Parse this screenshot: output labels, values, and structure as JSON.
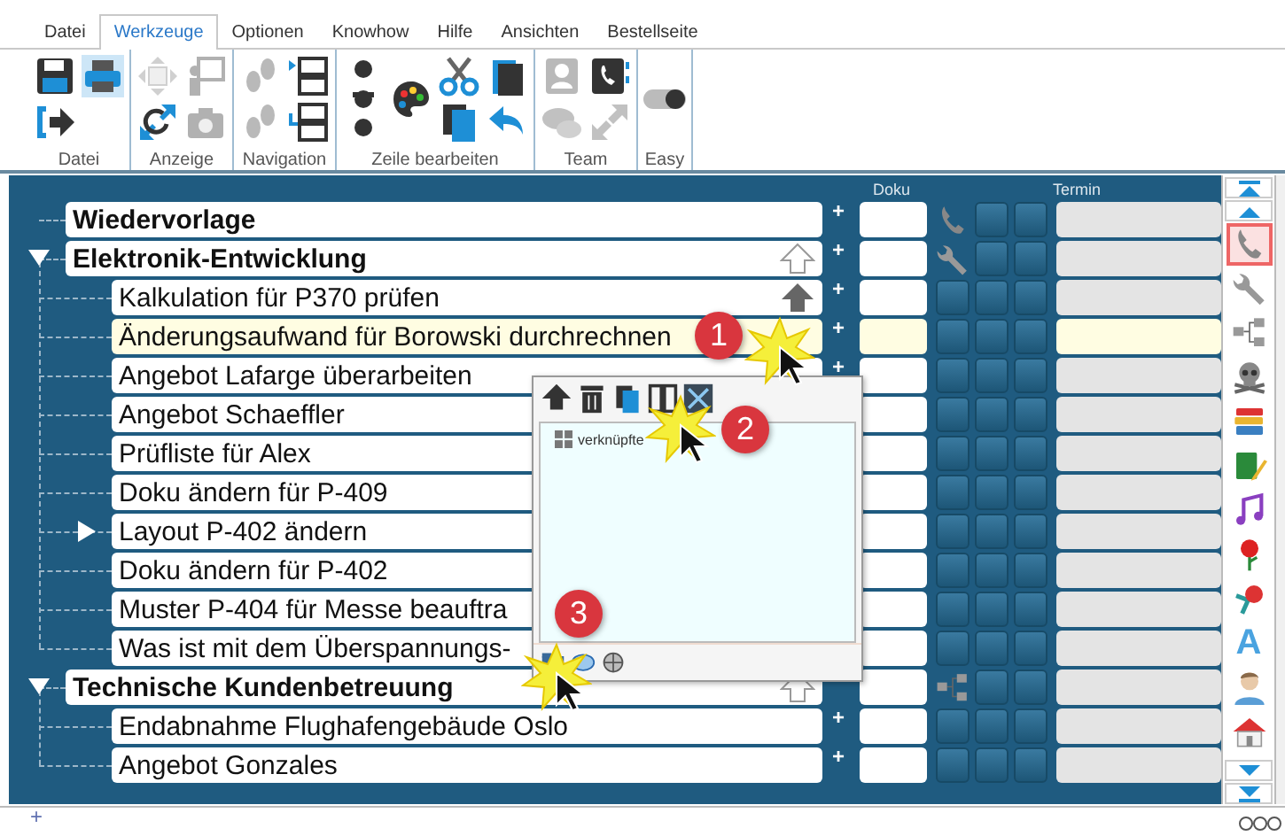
{
  "tabs": [
    {
      "label": "Datei",
      "selected": false
    },
    {
      "label": "Werkzeuge",
      "selected": true
    },
    {
      "label": "Optionen",
      "selected": false
    },
    {
      "label": "Knowhow",
      "selected": false
    },
    {
      "label": "Hilfe",
      "selected": false
    },
    {
      "label": "Ansichten",
      "selected": false
    },
    {
      "label": "Bestellseite",
      "selected": false
    }
  ],
  "ribbon": {
    "groups": [
      {
        "label": "Datei",
        "tools": [
          {
            "kind": "save",
            "disabled": false,
            "selected": false
          },
          {
            "kind": "exit",
            "disabled": false,
            "selected": false
          },
          {
            "kind": "print",
            "disabled": false,
            "selected": true
          }
        ]
      },
      {
        "label": "Anzeige",
        "tools": [
          {
            "kind": "move",
            "disabled": true,
            "selected": false
          },
          {
            "kind": "zoom",
            "disabled": false,
            "selected": false
          },
          {
            "kind": "presenter",
            "disabled": true,
            "selected": false
          },
          {
            "kind": "camera",
            "disabled": true,
            "selected": false
          }
        ]
      },
      {
        "label": "Navigation",
        "tools": [
          {
            "kind": "steps",
            "disabled": true,
            "selected": false
          },
          {
            "kind": "steps",
            "disabled": true,
            "selected": false
          },
          {
            "kind": "boxes_top",
            "disabled": false,
            "selected": false
          },
          {
            "kind": "boxes_bottom",
            "disabled": false,
            "selected": false
          }
        ]
      },
      {
        "label": "Zeile bearbeiten",
        "tools": [
          {
            "kind": "textstyle",
            "disabled": false,
            "selected": false
          },
          {
            "kind": "palette",
            "disabled": false,
            "selected": false
          },
          {
            "kind": "scissors",
            "disabled": false,
            "selected": false
          },
          {
            "kind": "copy",
            "disabled": false,
            "selected": false
          },
          {
            "kind": "paste",
            "disabled": false,
            "selected": false
          },
          {
            "kind": "undo",
            "disabled": false,
            "selected": false
          }
        ]
      },
      {
        "label": "Team",
        "tools": [
          {
            "kind": "contacts",
            "disabled": true,
            "selected": false
          },
          {
            "kind": "chat",
            "disabled": true,
            "selected": false
          },
          {
            "kind": "phonebook",
            "disabled": false,
            "selected": false
          },
          {
            "kind": "share",
            "disabled": true,
            "selected": false
          }
        ]
      },
      {
        "label": "Easy",
        "tools": [
          {
            "kind": "toggle",
            "disabled": false,
            "selected": false
          }
        ]
      }
    ]
  },
  "grid": {
    "columns": [
      {
        "label": "Doku"
      },
      {
        "label": "Termin"
      }
    ],
    "rows": [
      {
        "label": "Wiedervorlage",
        "selected": false,
        "plus": "+",
        "slot": {
          "kind": "phone"
        }
      },
      {
        "label": "Elektronik-Entwicklung",
        "selected": false,
        "expanded": true,
        "marker": {
          "kind": "outline"
        },
        "plus": "+",
        "slot": {
          "kind": "wrench"
        },
        "children": [
          {
            "label": "Kalkulation für P370 prüfen",
            "selected": false,
            "marker": {
              "kind": "filled"
            },
            "plus": "+"
          },
          {
            "label": "Änderungsaufwand für Borowski durchrechnen",
            "selected": true,
            "plus": "+"
          },
          {
            "label": "Angebot Lafarge überarbeiten",
            "selected": false,
            "plus": "+"
          },
          {
            "label": "Angebot Schaeffler",
            "selected": false
          },
          {
            "label": "Prüfliste für Alex",
            "selected": false
          },
          {
            "label": "Doku ändern für P-409",
            "selected": false
          },
          {
            "label": "Layout P-402 ändern",
            "selected": false,
            "expanded": false
          },
          {
            "label": "Doku ändern für P-402",
            "selected": false
          },
          {
            "label": "Muster P-404 für Messe beauftra",
            "selected": false
          },
          {
            "label": "Was ist mit dem Überspannungs-",
            "selected": false
          }
        ]
      },
      {
        "label": "Technische Kundenbetreuung",
        "selected": false,
        "expanded": true,
        "marker": {
          "kind": "outline"
        },
        "slot": {
          "kind": "network"
        },
        "children": [
          {
            "label": "Endabnahme Flughafengebäude Oslo",
            "selected": false,
            "plus": "+"
          },
          {
            "label": "Angebot Gonzales",
            "selected": false,
            "plus": "+"
          }
        ]
      }
    ]
  },
  "side_tools": [
    {
      "kind": "phone",
      "selected": true
    },
    {
      "kind": "wrench",
      "selected": false
    },
    {
      "kind": "network",
      "selected": false
    },
    {
      "kind": "skull",
      "selected": false
    },
    {
      "kind": "books",
      "selected": false
    },
    {
      "kind": "notebook",
      "selected": false
    },
    {
      "kind": "music",
      "selected": false
    },
    {
      "kind": "rose",
      "selected": false
    },
    {
      "kind": "flower",
      "selected": false
    },
    {
      "kind": "glyph",
      "label": "A",
      "selected": false
    },
    {
      "kind": "person",
      "selected": false
    },
    {
      "kind": "house",
      "selected": false
    }
  ],
  "link_panel": {
    "tree": [
      {
        "label": "verknüpfte"
      }
    ]
  },
  "callouts": [
    {
      "label": "1"
    },
    {
      "label": "2"
    },
    {
      "label": "3"
    }
  ],
  "footer": {
    "plus": "+"
  }
}
